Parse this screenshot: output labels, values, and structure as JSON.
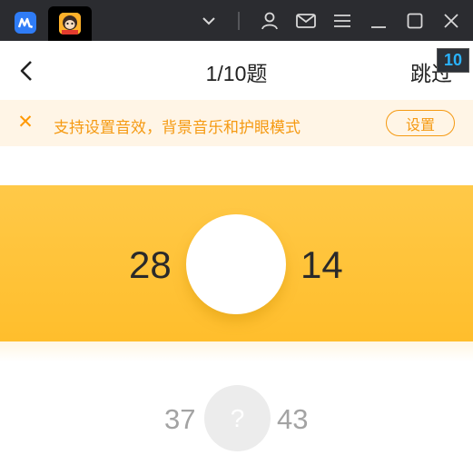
{
  "navbar": {
    "progress": "1/10题",
    "skip_label": "跳过",
    "count_badge": "10"
  },
  "notice": {
    "text": "支持设置音效，背景音乐和护眼模式",
    "button_label": "设置",
    "close_glyph": "✕"
  },
  "current_question": {
    "left_number": "28",
    "right_number": "14"
  },
  "next_question": {
    "left_number": "37",
    "placeholder": "?",
    "right_number": "43"
  },
  "colors": {
    "titlebar": "#2b2c30",
    "accent_orange": "#f59a12",
    "card_yellow": "#ffc13a",
    "notice_bg": "#fff5e6"
  },
  "icons": [
    "app-logo-icon",
    "app-avatar-icon",
    "chevron-down-icon",
    "user-icon",
    "mail-icon",
    "menu-icon",
    "minimize-icon",
    "maximize-icon",
    "close-icon",
    "back-arrow-icon"
  ]
}
